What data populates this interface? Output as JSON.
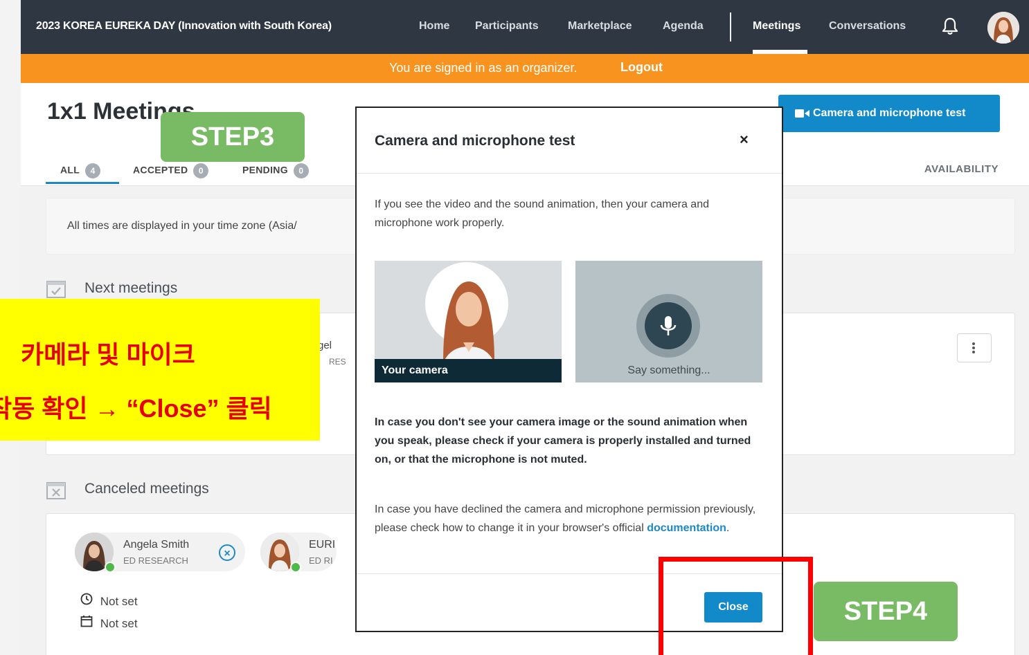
{
  "topbar": {
    "title": "2023 KOREA EUREKA DAY (Innovation with South Korea)",
    "nav": [
      "Home",
      "Participants",
      "Marketplace",
      "Agenda",
      "Meetings",
      "Conversations"
    ]
  },
  "orgbar": {
    "message": "You are signed in as an organizer.",
    "logout": "Logout"
  },
  "page": {
    "title": "1x1 Meetings",
    "tabs": [
      {
        "label": "ALL",
        "count": "4"
      },
      {
        "label": "ACCEPTED",
        "count": "0"
      },
      {
        "label": "PENDING",
        "count": "0"
      }
    ],
    "availability": "AVAILABILITY",
    "camera_test_button": "Camera and microphone test",
    "timezone_info": "All times are displayed in your time zone (Asia/",
    "next_meetings": "Next meetings",
    "canceled_meetings": "Canceled meetings",
    "next_card_partial_name": "gel",
    "next_card_partial_company": "RES",
    "canceled": [
      {
        "name": "Angela Smith",
        "company": "ED RESEARCH"
      },
      {
        "name": "EURI",
        "company": "ED RI"
      }
    ],
    "not_set_time": "Not set",
    "not_set_date": "Not set"
  },
  "modal": {
    "title": "Camera and microphone test",
    "close_x": "×",
    "intro": "If you see the video and the sound animation, then your camera and microphone work properly.",
    "your_camera": "Your camera",
    "say_something": "Say something...",
    "warning": "In case you don't see your camera image or the sound animation when you speak, please check if your camera is properly installed and turned on, or that the microphone is not muted.",
    "declined_text": "In case you have declined the camera and microphone permission previously, please check how to change it in your browser's official",
    "doc_link": "documentation",
    "doc_period": ".",
    "close_button": "Close"
  },
  "annotations": {
    "step3": "STEP3",
    "step4": "STEP4",
    "korean_line1": "카메라 및 마이크",
    "korean_line2": "작동 확인 → “Close” 클릭"
  },
  "colors": {
    "accent": "#1289c9",
    "topbar": "#2f3842",
    "orgbar": "#f7931e",
    "step": "#78bb64",
    "highlight": "#ffff00",
    "alert": "#ff0000"
  }
}
